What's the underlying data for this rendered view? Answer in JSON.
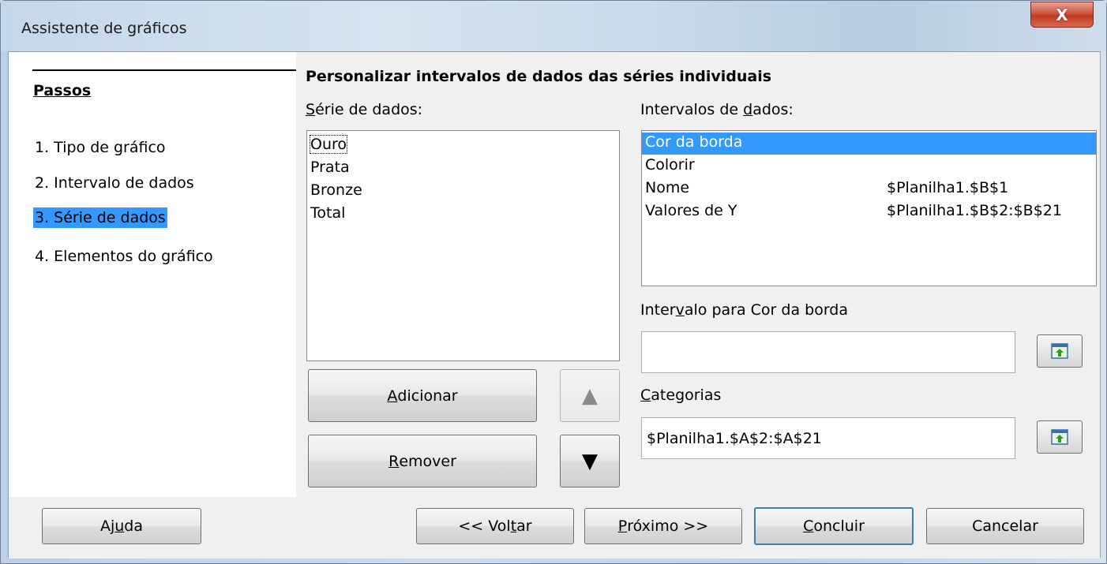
{
  "window": {
    "title": "Assistente de gráficos",
    "close_label": "X"
  },
  "steps": {
    "heading": "Passos",
    "items": [
      {
        "label": "1. Tipo de gráfico"
      },
      {
        "label": "2. Intervalo de dados"
      },
      {
        "label": "3. Série de dados",
        "active": true
      },
      {
        "label": "4. Elementos do gráfico"
      }
    ]
  },
  "main": {
    "section_title": "Personalizar intervalos de dados das séries individuais",
    "series_label": {
      "pre": "",
      "ul": "S",
      "post": "érie de dados:"
    },
    "series": [
      "Ouro",
      "Prata",
      "Bronze",
      "Total"
    ],
    "selected_series": "Ouro",
    "ranges_label": {
      "pre": "Intervalos de ",
      "ul": "d",
      "post": "ados:"
    },
    "ranges": [
      {
        "name": "Cor da borda",
        "value": "",
        "selected": true
      },
      {
        "name": "Colorir",
        "value": ""
      },
      {
        "name": "Nome",
        "value": "$Planilha1.$B$1"
      },
      {
        "name": "Valores de Y",
        "value": "$Planilha1.$B$2:$B$21"
      }
    ],
    "range_for_label": {
      "pre": "Inter",
      "ul": "v",
      "post": "alo para Cor da borda"
    },
    "range_for_value": "",
    "categories_label": {
      "pre": "",
      "ul": "C",
      "post": "ategorias"
    },
    "categories_value": "$Planilha1.$A$2:$A$21",
    "add_button": {
      "pre": "",
      "ul": "A",
      "post": "dicionar"
    },
    "remove_button": {
      "pre": "",
      "ul": "R",
      "post": "emover"
    },
    "move_up_glyph": "▲",
    "move_down_glyph": "▼"
  },
  "footer": {
    "help": {
      "pre": "Aj",
      "ul": "u",
      "post": "da"
    },
    "back": {
      "pre": "<< Vol",
      "ul": "t",
      "post": "ar"
    },
    "next": {
      "pre": "",
      "ul": "P",
      "post": "róximo >>"
    },
    "finish": {
      "pre": "",
      "ul": "C",
      "post": "oncluir"
    },
    "cancel": {
      "pre": "Cancelar",
      "ul": "",
      "post": ""
    }
  }
}
